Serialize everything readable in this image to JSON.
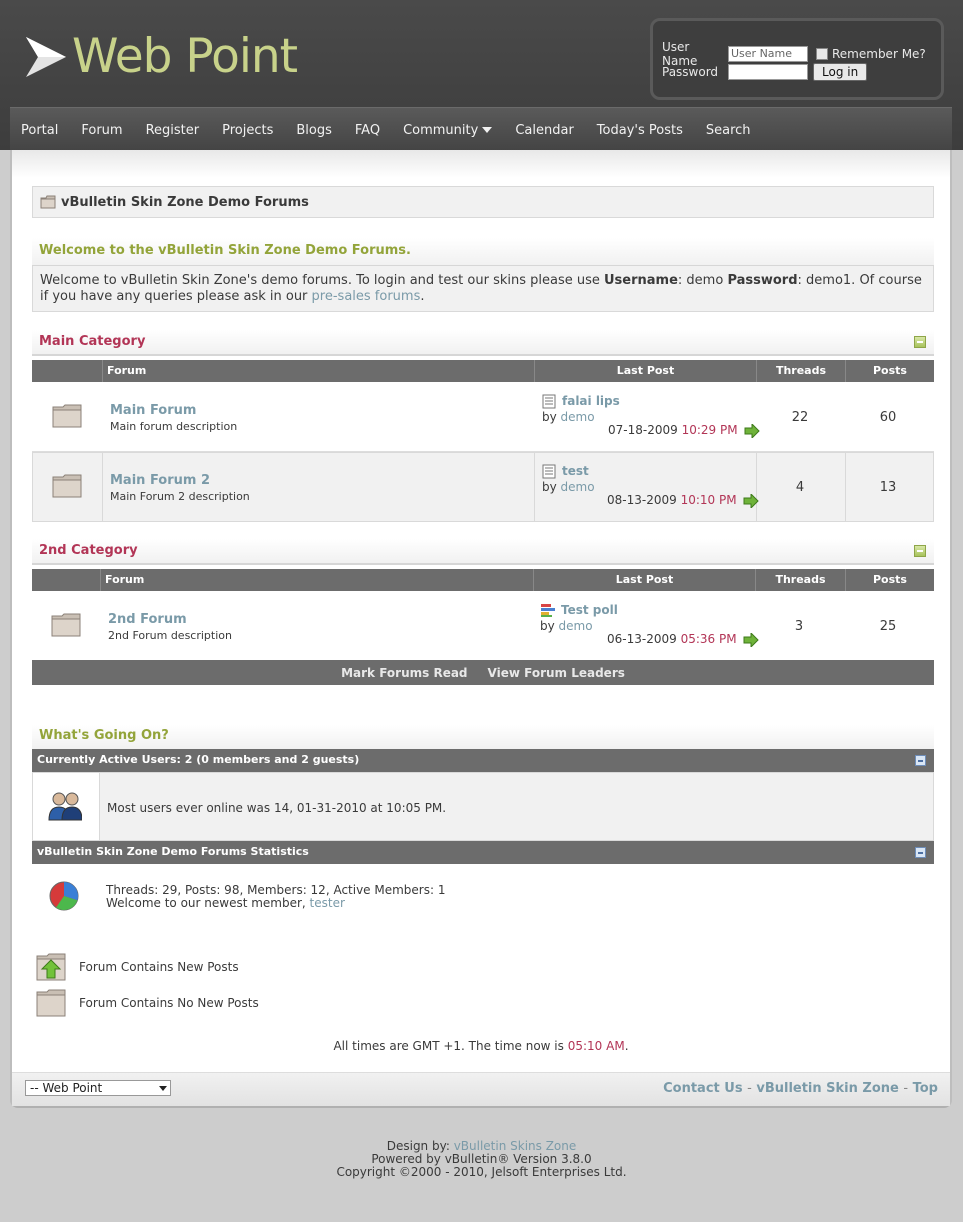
{
  "header": {
    "logo_text": "Web Point",
    "login": {
      "username_label": "User Name",
      "username_value": "User Name",
      "password_label": "Password",
      "remember_label": "Remember Me?",
      "login_button": "Log in"
    }
  },
  "nav": {
    "items": [
      "Portal",
      "Forum",
      "Register",
      "Projects",
      "Blogs",
      "FAQ",
      "Community",
      "Calendar",
      "Today's Posts",
      "Search"
    ]
  },
  "breadcrumb": {
    "title": "vBulletin Skin Zone Demo Forums"
  },
  "welcome": {
    "title": "Welcome to the vBulletin Skin Zone Demo Forums.",
    "text_1": "Welcome to vBulletin Skin Zone's demo forums. To login and test our skins please use ",
    "username_bold": "Username",
    "text_2": ": demo ",
    "password_bold": "Password",
    "text_3": ": demo1. Of course if you have any queries please ask in our ",
    "link": "pre-sales forums",
    "text_4": "."
  },
  "table_headers": {
    "forum": "Forum",
    "last_post": "Last Post",
    "threads": "Threads",
    "posts": "Posts"
  },
  "categories": [
    {
      "title": "Main Category",
      "forums": [
        {
          "title": "Main Forum",
          "description": "Main forum description",
          "last_post_title": "falai lips",
          "by": "by",
          "author": "demo",
          "date": "07-18-2009",
          "time": "10:29 PM",
          "threads": "22",
          "posts": "60"
        },
        {
          "title": "Main Forum 2",
          "description": "Main Forum 2 description",
          "last_post_title": "test",
          "by": "by",
          "author": "demo",
          "date": "08-13-2009",
          "time": "10:10 PM",
          "threads": "4",
          "posts": "13"
        }
      ]
    },
    {
      "title": "2nd Category",
      "forums": [
        {
          "title": "2nd Forum",
          "description": "2nd Forum description",
          "last_post_title": "Test poll",
          "by": "by",
          "author": "demo",
          "date": "06-13-2009",
          "time": "05:36 PM",
          "threads": "3",
          "posts": "25"
        }
      ]
    }
  ],
  "actions": {
    "mark_read": "Mark Forums Read",
    "view_leaders": "View Forum Leaders"
  },
  "whats_going_on": {
    "title": "What's Going On?",
    "active_users_bar": "Currently Active Users: 2 (0 members and 2 guests)",
    "most_users": "Most users ever online was 14, 01-31-2010 at 10:05 PM.",
    "stats_bar": "vBulletin Skin Zone Demo Forums Statistics",
    "stats_line": "Threads: 29, Posts: 98, Members: 12, Active Members: 1",
    "newest_prefix": "Welcome to our newest member, ",
    "newest_member": "tester"
  },
  "legend": {
    "new_posts": "Forum Contains New Posts",
    "no_new_posts": "Forum Contains No New Posts"
  },
  "time_info": {
    "prefix": "All times are GMT +1. The time now is ",
    "time": "05:10 AM",
    "suffix": "."
  },
  "footer": {
    "style_select": "-- Web Point",
    "contact": "Contact Us",
    "skin_zone": "vBulletin Skin Zone",
    "top": "Top",
    "separator": "-"
  },
  "copyright": {
    "design_prefix": "Design by: ",
    "design_link": "vBulletin Skins Zone",
    "powered": "Powered by vBulletin® Version 3.8.0",
    "copy": "Copyright ©2000 - 2010, Jelsoft Enterprises Ltd."
  },
  "colors": {
    "accent_green": "#93a43a",
    "category_red": "#b23556",
    "link_blue": "#7a9aa8",
    "bar_gray": "#6c6c6c"
  }
}
